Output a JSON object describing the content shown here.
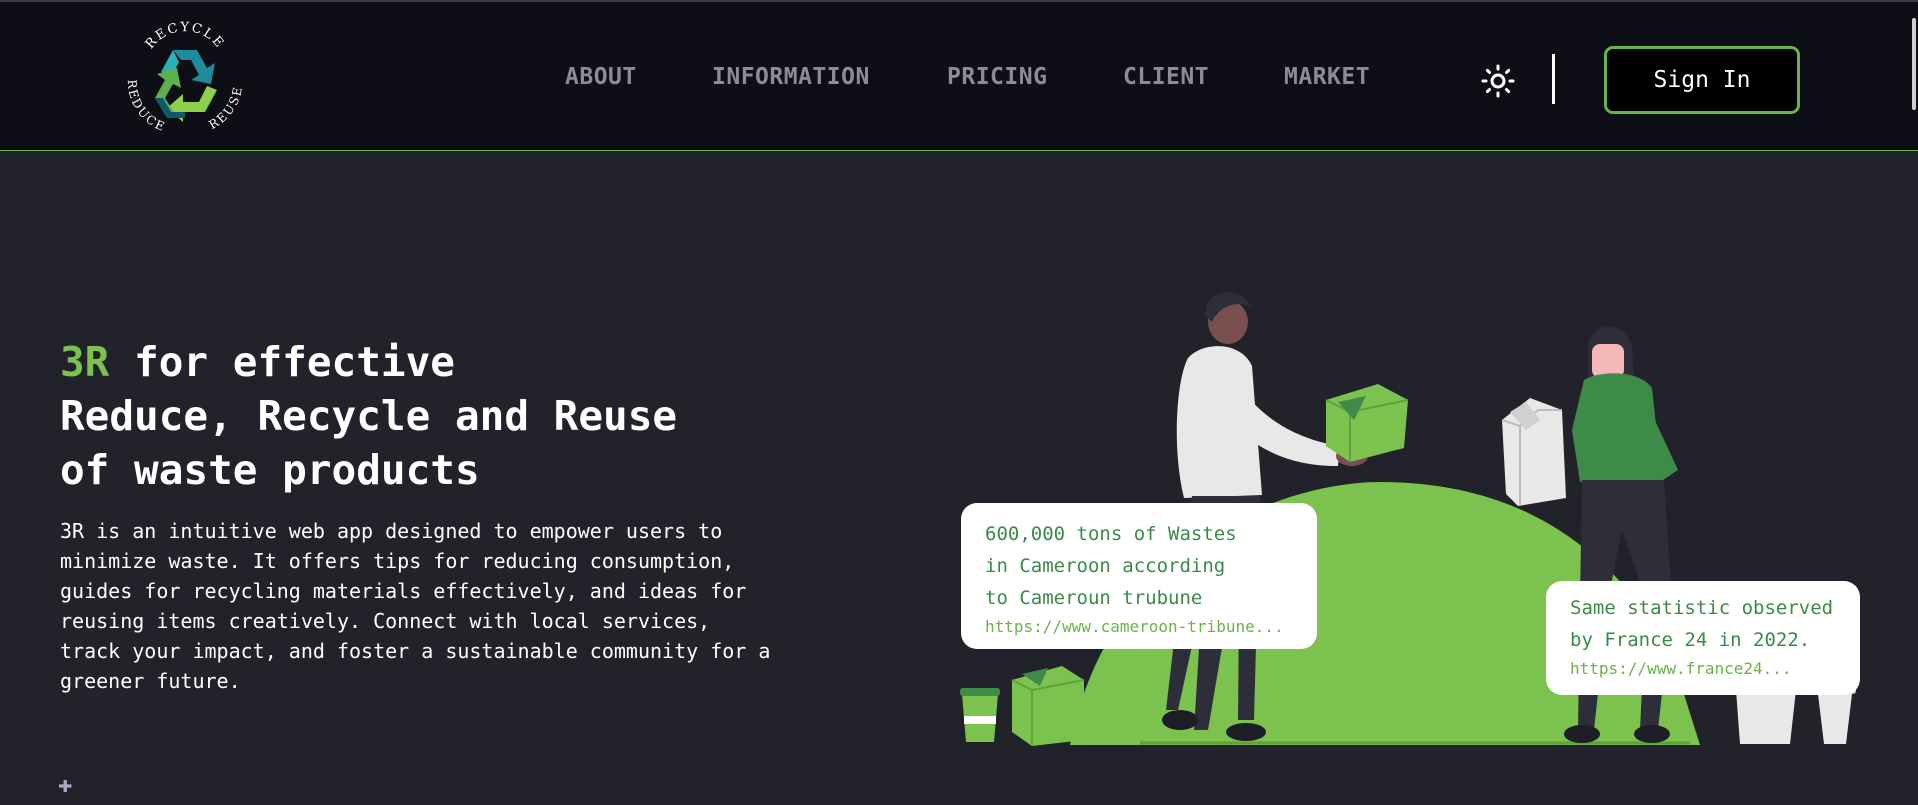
{
  "logo": {
    "top_text": "RECYCLE",
    "left_text": "REDUCE",
    "right_text": "REUSE"
  },
  "nav": {
    "items": [
      {
        "label": "ABOUT"
      },
      {
        "label": "INFORMATION"
      },
      {
        "label": "PRICING"
      },
      {
        "label": "CLIENT"
      },
      {
        "label": "MARKET"
      }
    ],
    "theme_icon": "sun-icon",
    "signin_label": "Sign In"
  },
  "hero": {
    "title_accent": "3R",
    "title_line1_rest": " for effective",
    "title_line2": "Reduce, Recycle and Reuse",
    "title_line3": "of waste products",
    "description": "3R is an intuitive web app designed to empower users to minimize waste. It offers tips for reducing consumption, guides for recycling materials effectively, and ideas for reusing items creatively. Connect with local services, track your impact, and foster a sustainable community for a greener future."
  },
  "stats": [
    {
      "lines": [
        "600,000 tons of Wastes",
        "in Cameroon according",
        "to Cameroun trubune"
      ],
      "link": "https://www.cameroon-tribune..."
    },
    {
      "lines": [
        "Same statistic observed",
        "by France 24 in 2022."
      ],
      "link": "https://www.france24..."
    }
  ],
  "colors": {
    "accent": "#7cc24e",
    "background": "#22222a",
    "navbar": "#0e0e16",
    "stat_text": "#3a8a4a"
  }
}
